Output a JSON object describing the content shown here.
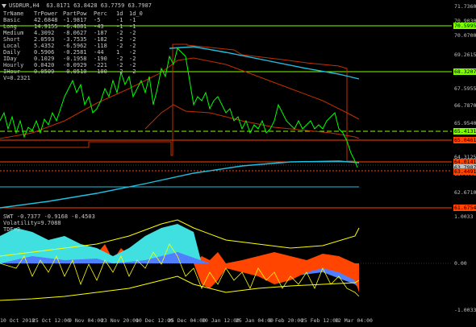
{
  "chart": {
    "title": "USDRUR,H4  63.8171 63.8428 63.7759 63.7987"
  },
  "info_table": {
    "headers": [
      "TrName",
      "TrPower",
      "PartPow",
      "Perc",
      "1d",
      "1d_0"
    ],
    "rows": [
      [
        "Basic",
        "42.6848",
        "-1.9817",
        "-5",
        "-1",
        "-1"
      ],
      [
        "Long",
        "14.9155",
        "-6.4881",
        "-43",
        "-1",
        "-1"
      ],
      [
        "Medium",
        "4.3092",
        "-8.0627",
        "-187",
        "-2",
        "-2"
      ],
      [
        "Short",
        "2.0593",
        "-3.7535",
        "-182",
        "-2",
        "-2"
      ],
      [
        "Local",
        "5.4352",
        "-6.5962",
        "-118",
        "-2",
        "-2"
      ],
      [
        "Daily",
        "0.5906",
        "-0.2581",
        "-44",
        "1",
        "-2"
      ],
      [
        "IDay",
        "0.1029",
        "-0.1958",
        "-190",
        "-2",
        "-2"
      ],
      [
        "Hourly",
        "0.0420",
        "-0.0929",
        "-221",
        "-2",
        "-2"
      ],
      [
        "IHour",
        "0.0509",
        "-0.0510",
        "-100",
        "-2",
        "-2"
      ]
    ],
    "footer": "V=0.2321"
  },
  "price_axis": {
    "ticks": [
      "71.7360",
      "70.9030",
      "70.0700",
      "69.2615",
      "68.4285",
      "67.5955",
      "66.7870",
      "65.9540",
      "65.1210",
      "64.3125",
      "63.4795",
      "62.6710",
      "61.8380"
    ],
    "tags": [
      {
        "label": "70.5995",
        "color": "#7fff00"
      },
      {
        "label": "68.3207",
        "color": "#7fff00"
      },
      {
        "label": "65.4131",
        "color": "#7fff00"
      },
      {
        "label": "65.0461",
        "color": "#ff4500"
      },
      {
        "label": "64.0141",
        "color": "#ff4500"
      },
      {
        "label": "63.7987",
        "color": "#c0c0c0"
      },
      {
        "label": "63.4491",
        "color": "#ff4500"
      },
      {
        "label": "61.6754",
        "color": "#ff4500"
      }
    ]
  },
  "oscillator": {
    "label_line1": "SWT -0.7377 -0.9168 -0.4503",
    "label_line2": "Volatility=9.7088",
    "label_line3": "TDF=2",
    "ticks": [
      "1.0033",
      "0.00",
      "-1.0033"
    ]
  },
  "time_axis": {
    "labels": [
      "10 Oct 2018",
      "25 Oct 12:00",
      "9 Nov 04:00",
      "23 Nov 20:00",
      "10 Dec 12:00",
      "25 Dec 04:00",
      "10 Jan 12:00",
      "25 Jan 04:00",
      "8 Feb 20:00",
      "25 Feb 12:00",
      "12 Mar 04:00"
    ]
  },
  "colors": {
    "price": "#00ff00",
    "ma_cyan": "#20c0e0",
    "ma_red": "#c03000",
    "osc_orange": "#ff4500",
    "osc_cyan": "#40e0e0",
    "osc_yellow": "#ffff00",
    "osc_blue": "#5080ff"
  }
}
